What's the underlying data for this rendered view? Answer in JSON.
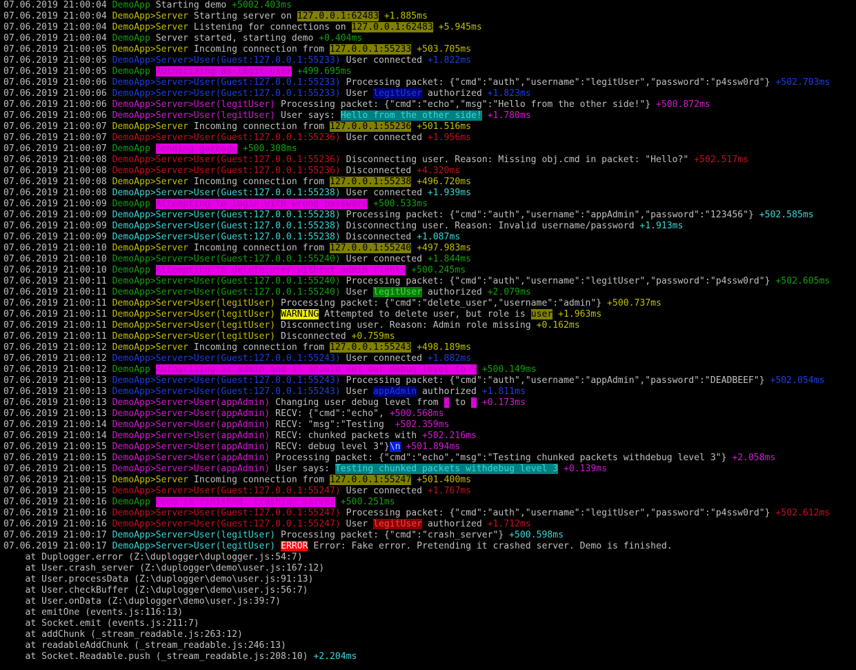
{
  "colors": {
    "ts": "#c0c0c0",
    "text": "#c0c0c0",
    "demo": "#13a10e",
    "yellow": "#c1c000",
    "blue": "#1b3fe0",
    "cyan": "#3ad6d6",
    "red": "#c50f1f",
    "magenta": "#d31ad3",
    "darkgreen": "#13a10e",
    "bg_ip": "#808000",
    "bg_magenta": "#e500e5",
    "bg_teal": "#008080",
    "bg_navy": "#000080",
    "bg_green": "#0a7a0a",
    "bg_yellow": "#f0f000",
    "bg_darkred": "#8b0000",
    "bg_red": "#ff0000",
    "bg_blue": "#0020e0"
  },
  "lines": [
    [
      [
        "07.06.2019 21:00:04 ",
        "ts"
      ],
      [
        "DemoApp",
        "demo"
      ],
      [
        " Starting demo ",
        ""
      ],
      [
        "+5002.403ms",
        "demo"
      ]
    ],
    [
      [
        "07.06.2019 21:00:04 ",
        "ts"
      ],
      [
        "DemoApp>Server",
        "yellow"
      ],
      [
        " Starting server on ",
        ""
      ],
      [
        "127.0.0.1:62483",
        "",
        "bg_ip",
        "#000"
      ],
      [
        " +1.885ms",
        "yellow"
      ]
    ],
    [
      [
        "07.06.2019 21:00:04 ",
        "ts"
      ],
      [
        "DemoApp>Server",
        "yellow"
      ],
      [
        " Listening for connections on ",
        ""
      ],
      [
        "127.0.0.1:62483",
        "",
        "bg_ip",
        "#000"
      ],
      [
        " +5.945ms",
        "yellow"
      ]
    ],
    [
      [
        "07.06.2019 21:00:04 ",
        "ts"
      ],
      [
        "DemoApp",
        "demo"
      ],
      [
        " Server started, starting demo ",
        ""
      ],
      [
        "+0.404ms",
        "demo"
      ]
    ],
    [
      [
        "07.06.2019 21:00:05 ",
        "ts"
      ],
      [
        "DemoApp>Server",
        "yellow"
      ],
      [
        " Incoming connection from ",
        ""
      ],
      [
        "127.0.0.1:55233",
        "",
        "bg_ip",
        "#000"
      ],
      [
        " +503.705ms",
        "yellow"
      ]
    ],
    [
      [
        "07.06.2019 21:00:05 ",
        "ts"
      ],
      [
        "DemoApp>Server>User(Guest:127.0.0.1:55233)",
        "blue"
      ],
      [
        " User connected ",
        ""
      ],
      [
        "+1.822ms",
        "blue"
      ]
    ],
    [
      [
        "07.06.2019 21:00:05 ",
        "ts"
      ],
      [
        "DemoApp",
        "demo"
      ],
      [
        " ",
        ""
      ],
      [
        "Authorizing as legit user",
        "magenta",
        "bg_magenta",
        "#c000c0"
      ],
      [
        " +499.695ms",
        "demo"
      ]
    ],
    [
      [
        "07.06.2019 21:00:06 ",
        "ts"
      ],
      [
        "DemoApp>Server>User(Guest:127.0.0.1:55233)",
        "blue"
      ],
      [
        " Processing packet: {\"cmd\":\"auth\",\"username\":\"legitUser\",\"password\":\"p4ssw0rd\"} ",
        ""
      ],
      [
        "+502.703ms",
        "blue"
      ]
    ],
    [
      [
        "07.06.2019 21:00:06 ",
        "ts"
      ],
      [
        "DemoApp>Server>User(Guest:127.0.0.1:55233)",
        "blue"
      ],
      [
        " User ",
        ""
      ],
      [
        "legitUser",
        "",
        "bg_navy",
        "#1b3fe0"
      ],
      [
        " authorized ",
        ""
      ],
      [
        "+1.823ms",
        "blue"
      ]
    ],
    [
      [
        "07.06.2019 21:00:06 ",
        "ts"
      ],
      [
        "DemoApp>Server>User(legitUser)",
        "magenta"
      ],
      [
        " Processing packet: {\"cmd\":\"echo\",\"msg\":\"Hello from the other side!\"} ",
        ""
      ],
      [
        "+500.872ms",
        "magenta"
      ]
    ],
    [
      [
        "07.06.2019 21:00:06 ",
        "ts"
      ],
      [
        "DemoApp>Server>User(legitUser)",
        "magenta"
      ],
      [
        " User says: ",
        ""
      ],
      [
        "Hello from the other side!",
        "",
        "bg_teal",
        "#3ad6d6"
      ],
      [
        " +1.780ms",
        "magenta"
      ]
    ],
    [
      [
        "07.06.2019 21:00:07 ",
        "ts"
      ],
      [
        "DemoApp>Server",
        "yellow"
      ],
      [
        " Incoming connection from ",
        ""
      ],
      [
        "127.0.0.1:55236",
        "",
        "bg_ip",
        "#000"
      ],
      [
        " +501.516ms",
        "yellow"
      ]
    ],
    [
      [
        "07.06.2019 21:00:07 ",
        "ts"
      ],
      [
        "DemoApp>Server>User(Guest:127.0.0.1:55236)",
        "red"
      ],
      [
        " User connected ",
        ""
      ],
      [
        "+1.956ms",
        "red"
      ]
    ],
    [
      [
        "07.06.2019 21:00:07 ",
        "ts"
      ],
      [
        "DemoApp",
        "demo"
      ],
      [
        " ",
        ""
      ],
      [
        "Sending garbage",
        "",
        "bg_magenta",
        "#c000c0"
      ],
      [
        " +500.308ms",
        "demo"
      ]
    ],
    [
      [
        "07.06.2019 21:00:08 ",
        "ts"
      ],
      [
        "DemoApp>Server>User(Guest:127.0.0.1:55236)",
        "red"
      ],
      [
        " Disconnecting user. Reason: Missing obj.cmd in packet: \"Hello?\" ",
        ""
      ],
      [
        "+502.517ms",
        "red"
      ]
    ],
    [
      [
        "07.06.2019 21:00:08 ",
        "ts"
      ],
      [
        "DemoApp>Server>User(Guest:127.0.0.1:55236)",
        "red"
      ],
      [
        " Disconnected ",
        ""
      ],
      [
        "+4.320ms",
        "red"
      ]
    ],
    [
      [
        "07.06.2019 21:00:08 ",
        "ts"
      ],
      [
        "DemoApp>Server",
        "yellow"
      ],
      [
        " Incoming connection from ",
        ""
      ],
      [
        "127.0.0.1:55238",
        "",
        "bg_ip",
        "#000"
      ],
      [
        " +496.720ms",
        "yellow"
      ]
    ],
    [
      [
        "07.06.2019 21:00:08 ",
        "ts"
      ],
      [
        "DemoApp>Server>User(Guest:127.0.0.1:55238)",
        "cyan"
      ],
      [
        " User connected ",
        ""
      ],
      [
        "+1.939ms",
        "cyan"
      ]
    ],
    [
      [
        "07.06.2019 21:00:09 ",
        "ts"
      ],
      [
        "DemoApp",
        "demo"
      ],
      [
        " ",
        ""
      ],
      [
        "Attempting to login with wrong password",
        "",
        "bg_magenta",
        "#c000c0"
      ],
      [
        " +500.533ms",
        "demo"
      ]
    ],
    [
      [
        "07.06.2019 21:00:09 ",
        "ts"
      ],
      [
        "DemoApp>Server>User(Guest:127.0.0.1:55238)",
        "cyan"
      ],
      [
        " Processing packet: {\"cmd\":\"auth\",\"username\":\"appAdmin\",\"password\":\"123456\"} ",
        ""
      ],
      [
        "+502.585ms",
        "cyan"
      ]
    ],
    [
      [
        "07.06.2019 21:00:09 ",
        "ts"
      ],
      [
        "DemoApp>Server>User(Guest:127.0.0.1:55238)",
        "cyan"
      ],
      [
        " Disconnecting user. Reason: Invalid username/password ",
        ""
      ],
      [
        "+1.913ms",
        "cyan"
      ]
    ],
    [
      [
        "07.06.2019 21:00:09 ",
        "ts"
      ],
      [
        "DemoApp>Server>User(Guest:127.0.0.1:55238)",
        "cyan"
      ],
      [
        " Disconnected ",
        ""
      ],
      [
        "+1.087ms",
        "cyan"
      ]
    ],
    [
      [
        "07.06.2019 21:00:10 ",
        "ts"
      ],
      [
        "DemoApp>Server",
        "yellow"
      ],
      [
        " Incoming connection from ",
        ""
      ],
      [
        "127.0.0.1:55240",
        "",
        "bg_ip",
        "#000"
      ],
      [
        " +497.983ms",
        "yellow"
      ]
    ],
    [
      [
        "07.06.2019 21:00:10 ",
        "ts"
      ],
      [
        "DemoApp>Server>User(Guest:127.0.0.1:55240)",
        "demo"
      ],
      [
        " User connected ",
        ""
      ],
      [
        "+1.844ms",
        "demo"
      ]
    ],
    [
      [
        "07.06.2019 21:00:10 ",
        "ts"
      ],
      [
        "DemoApp",
        "demo"
      ],
      [
        " ",
        ""
      ],
      [
        "Attempting to delete user without admin rights",
        "",
        "bg_magenta",
        "#c000c0"
      ],
      [
        " +500.245ms",
        "demo"
      ]
    ],
    [
      [
        "07.06.2019 21:00:11 ",
        "ts"
      ],
      [
        "DemoApp>Server>User(Guest:127.0.0.1:55240)",
        "demo"
      ],
      [
        " Processing packet: {\"cmd\":\"auth\",\"username\":\"legitUser\",\"password\":\"p4ssw0rd\"} ",
        ""
      ],
      [
        "+502.605ms",
        "demo"
      ]
    ],
    [
      [
        "07.06.2019 21:00:11 ",
        "ts"
      ],
      [
        "DemoApp>Server>User(Guest:127.0.0.1:55240)",
        "demo"
      ],
      [
        " User ",
        ""
      ],
      [
        "legitUser",
        "",
        "bg_green",
        "#3ce23c"
      ],
      [
        " authorized ",
        ""
      ],
      [
        "+2.079ms",
        "demo"
      ]
    ],
    [
      [
        "07.06.2019 21:00:11 ",
        "ts"
      ],
      [
        "DemoApp>Server>User(legitUser)",
        "yellow"
      ],
      [
        " Processing packet: {\"cmd\":\"delete_user\",\"username\":\"admin\"} ",
        ""
      ],
      [
        "+500.737ms",
        "yellow"
      ]
    ],
    [
      [
        "07.06.2019 21:00:11 ",
        "ts"
      ],
      [
        "DemoApp>Server>User(legitUser)",
        "yellow"
      ],
      [
        " ",
        ""
      ],
      [
        "WARNING",
        "",
        "bg_yellow",
        "#000"
      ],
      [
        " Attempted to delete user, but role is ",
        ""
      ],
      [
        "user",
        "",
        "bg_ip",
        "#000"
      ],
      [
        " +1.963ms",
        "yellow"
      ]
    ],
    [
      [
        "07.06.2019 21:00:11 ",
        "ts"
      ],
      [
        "DemoApp>Server>User(legitUser)",
        "yellow"
      ],
      [
        " Disconnecting user. Reason: Admin role missing ",
        ""
      ],
      [
        "+0.162ms",
        "yellow"
      ]
    ],
    [
      [
        "07.06.2019 21:00:11 ",
        "ts"
      ],
      [
        "DemoApp>Server>User(legitUser)",
        "yellow"
      ],
      [
        " Disconnected ",
        ""
      ],
      [
        "+0.759ms",
        "yellow"
      ]
    ],
    [
      [
        "07.06.2019 21:00:12 ",
        "ts"
      ],
      [
        "DemoApp>Server",
        "yellow"
      ],
      [
        " Incoming connection from ",
        ""
      ],
      [
        "127.0.0.1:55243",
        "",
        "bg_ip",
        "#000"
      ],
      [
        " +498.189ms",
        "yellow"
      ]
    ],
    [
      [
        "07.06.2019 21:00:12 ",
        "ts"
      ],
      [
        "DemoApp>Server>User(Guest:127.0.0.1:55243)",
        "blue"
      ],
      [
        " User connected ",
        ""
      ],
      [
        "+1.882ms",
        "blue"
      ]
    ],
    [
      [
        "07.06.2019 21:00:12 ",
        "ts"
      ],
      [
        "DemoApp",
        "demo"
      ],
      [
        " ",
        ""
      ],
      [
        "Authorizing as admin and it should set our debug level to 3",
        "",
        "bg_magenta",
        "#c000c0"
      ],
      [
        " +500.149ms",
        "demo"
      ]
    ],
    [
      [
        "07.06.2019 21:00:13 ",
        "ts"
      ],
      [
        "DemoApp>Server>User(Guest:127.0.0.1:55243)",
        "blue"
      ],
      [
        " Processing packet: {\"cmd\":\"auth\",\"username\":\"appAdmin\",\"password\":\"DEADBEEF\"} ",
        ""
      ],
      [
        "+502.054ms",
        "blue"
      ]
    ],
    [
      [
        "07.06.2019 21:00:13 ",
        "ts"
      ],
      [
        "DemoApp>Server>User(Guest:127.0.0.1:55243)",
        "blue"
      ],
      [
        " User ",
        ""
      ],
      [
        "appAdmin",
        "",
        "bg_navy",
        "#1b3fe0"
      ],
      [
        " authorized ",
        ""
      ],
      [
        "+1.811ms",
        "blue"
      ]
    ],
    [
      [
        "07.06.2019 21:00:13 ",
        "ts"
      ],
      [
        "DemoApp>Server>User(appAdmin)",
        "magenta"
      ],
      [
        " Changing user debug level from ",
        ""
      ],
      [
        "2",
        "",
        "bg_magenta",
        "#c000c0"
      ],
      [
        " to ",
        ""
      ],
      [
        "3",
        "",
        "bg_magenta",
        "#c000c0"
      ],
      [
        " +0.173ms",
        "magenta"
      ]
    ],
    [
      [
        "07.06.2019 21:00:13 ",
        "ts"
      ],
      [
        "DemoApp>Server>User(appAdmin)",
        "magenta"
      ],
      [
        " RECV: {\"cmd\":\"echo\", ",
        ""
      ],
      [
        "+500.568ms",
        "magenta"
      ]
    ],
    [
      [
        "07.06.2019 21:00:14 ",
        "ts"
      ],
      [
        "DemoApp>Server>User(appAdmin)",
        "magenta"
      ],
      [
        " RECV: \"msg\":\"Testing  ",
        ""
      ],
      [
        "+502.359ms",
        "magenta"
      ]
    ],
    [
      [
        "07.06.2019 21:00:14 ",
        "ts"
      ],
      [
        "DemoApp>Server>User(appAdmin)",
        "magenta"
      ],
      [
        " RECV: chunked packets with ",
        ""
      ],
      [
        "+502.216ms",
        "magenta"
      ]
    ],
    [
      [
        "07.06.2019 21:00:15 ",
        "ts"
      ],
      [
        "DemoApp>Server>User(appAdmin)",
        "magenta"
      ],
      [
        " RECV: debug level 3\"}",
        ""
      ],
      [
        "\\n",
        "",
        "bg_blue",
        "#c0c0ff"
      ],
      [
        " +501.894ms",
        "magenta"
      ]
    ],
    [
      [
        "07.06.2019 21:00:15 ",
        "ts"
      ],
      [
        "DemoApp>Server>User(appAdmin)",
        "magenta"
      ],
      [
        " Processing packet: {\"cmd\":\"echo\",\"msg\":\"Testing chunked packets withdebug level 3\"} ",
        ""
      ],
      [
        "+2.058ms",
        "magenta"
      ]
    ],
    [
      [
        "07.06.2019 21:00:15 ",
        "ts"
      ],
      [
        "DemoApp>Server>User(appAdmin)",
        "magenta"
      ],
      [
        " User says: ",
        ""
      ],
      [
        "Testing chunked packets withdebug level 3",
        "",
        "bg_teal",
        "#3ad6d6"
      ],
      [
        " +0.139ms",
        "magenta"
      ]
    ],
    [
      [
        "07.06.2019 21:00:15 ",
        "ts"
      ],
      [
        "DemoApp>Server",
        "yellow"
      ],
      [
        " Incoming connection from ",
        ""
      ],
      [
        "127.0.0.1:55247",
        "",
        "bg_ip",
        "#000"
      ],
      [
        " +501.400ms",
        "yellow"
      ]
    ],
    [
      [
        "07.06.2019 21:00:15 ",
        "ts"
      ],
      [
        "DemoApp>Server>User(Guest:127.0.0.1:55247)",
        "red"
      ],
      [
        " User connected ",
        ""
      ],
      [
        "+1.767ms",
        "red"
      ]
    ],
    [
      [
        "07.06.2019 21:00:16 ",
        "ts"
      ],
      [
        "DemoApp",
        "demo"
      ],
      [
        " ",
        ""
      ],
      [
        "Demo is finished, crashing server",
        "",
        "bg_magenta",
        "#c000c0"
      ],
      [
        " +500.251ms",
        "demo"
      ]
    ],
    [
      [
        "07.06.2019 21:00:16 ",
        "ts"
      ],
      [
        "DemoApp>Server>User(Guest:127.0.0.1:55247)",
        "red"
      ],
      [
        " Processing packet: {\"cmd\":\"auth\",\"username\":\"legitUser\",\"password\":\"p4ssw0rd\"} ",
        ""
      ],
      [
        "+502.612ms",
        "red"
      ]
    ],
    [
      [
        "07.06.2019 21:00:16 ",
        "ts"
      ],
      [
        "DemoApp>Server>User(Guest:127.0.0.1:55247)",
        "red"
      ],
      [
        " User ",
        ""
      ],
      [
        "legitUser",
        "",
        "bg_darkred",
        "#ff4040"
      ],
      [
        " authorized ",
        ""
      ],
      [
        "+1.712ms",
        "red"
      ]
    ],
    [
      [
        "07.06.2019 21:00:17 ",
        "ts"
      ],
      [
        "DemoApp>Server>User(legitUser)",
        "cyan"
      ],
      [
        " Processing packet: {\"cmd\":\"crash_server\"} ",
        ""
      ],
      [
        "+500.598ms",
        "cyan"
      ]
    ],
    [
      [
        "07.06.2019 21:00:17 ",
        "ts"
      ],
      [
        "DemoApp>Server>User(legitUser)",
        "cyan"
      ],
      [
        " ",
        ""
      ],
      [
        "ERROR",
        "",
        "bg_red",
        "#ffffff"
      ],
      [
        " Error: Fake error. Pretending it crashed server. Demo is finished.",
        ""
      ]
    ],
    [
      [
        "    at Duplogger.error (Z:\\duplogger\\duplogger.js:54:7)",
        ""
      ]
    ],
    [
      [
        "    at User.crash_server (Z:\\duplogger\\demo\\user.js:167:12)",
        ""
      ]
    ],
    [
      [
        "    at User.processData (Z:\\duplogger\\demo\\user.js:91:13)",
        ""
      ]
    ],
    [
      [
        "    at User.checkBuffer (Z:\\duplogger\\demo\\user.js:56:7)",
        ""
      ]
    ],
    [
      [
        "    at User.onData (Z:\\duplogger\\demo\\user.js:39:7)",
        ""
      ]
    ],
    [
      [
        "    at emitOne (events.js:116:13)",
        ""
      ]
    ],
    [
      [
        "    at Socket.emit (events.js:211:7)",
        ""
      ]
    ],
    [
      [
        "    at addChunk (_stream_readable.js:263:12)",
        ""
      ]
    ],
    [
      [
        "    at readableAddChunk (_stream_readable.js:246:13)",
        ""
      ]
    ],
    [
      [
        "    at Socket.Readable.push (_stream_readable.js:208:10) ",
        ""
      ],
      [
        "+2.204ms",
        "cyan"
      ]
    ]
  ]
}
